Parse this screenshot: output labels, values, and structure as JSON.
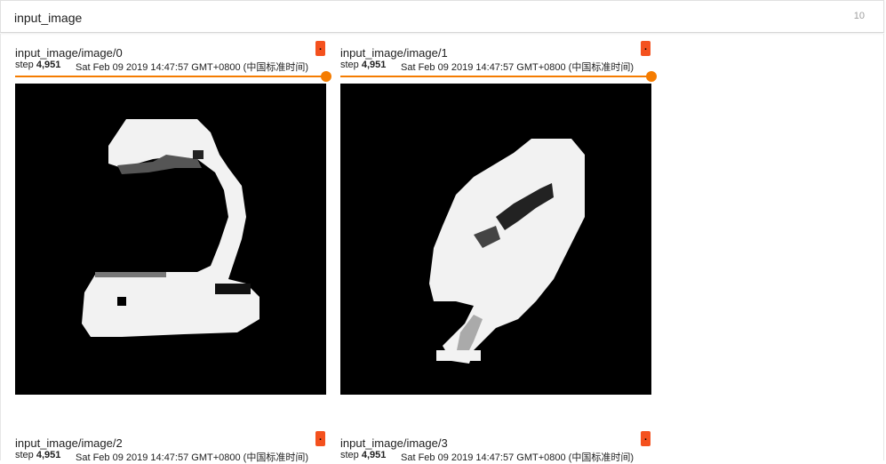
{
  "header": {
    "title": "input_image",
    "count": "10"
  },
  "cards": [
    {
      "name": "input_image/image/0",
      "flag": ".",
      "step_label": "step",
      "step_value": "4,951",
      "timestamp": "Sat Feb 09 2019 14:47:57 GMT+0800 (中国标准时间)"
    },
    {
      "name": "input_image/image/1",
      "flag": ".",
      "step_label": "step",
      "step_value": "4,951",
      "timestamp": "Sat Feb 09 2019 14:47:57 GMT+0800 (中国标准时间)"
    },
    {
      "name": "input_image/image/2",
      "flag": ".",
      "step_label": "step",
      "step_value": "4,951",
      "timestamp": "Sat Feb 09 2019 14:47:57 GMT+0800 (中国标准时间)"
    },
    {
      "name": "input_image/image/3",
      "flag": ".",
      "step_label": "step",
      "step_value": "4,951",
      "timestamp": "Sat Feb 09 2019 14:47:57 GMT+0800 (中国标准时间)"
    }
  ],
  "colors": {
    "accent": "#f57c00",
    "flag": "#f4511e",
    "image_bg": "#000000"
  }
}
